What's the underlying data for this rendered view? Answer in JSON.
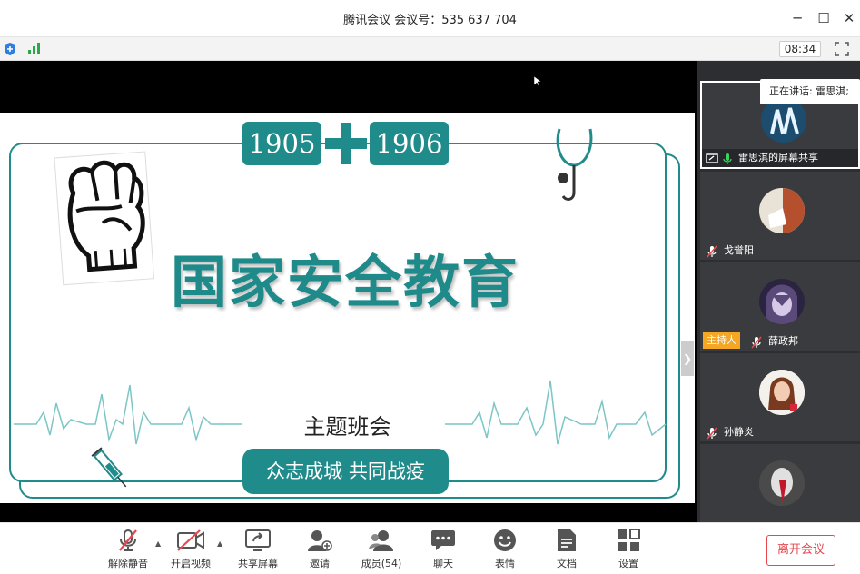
{
  "window": {
    "title": "腾讯会议 会议号：535 637 704",
    "minimize": "─",
    "maximize": "☐",
    "close": "✕"
  },
  "status": {
    "timer": "08:34",
    "icons": [
      "shield-icon",
      "signal-icon",
      "fullscreen-icon"
    ]
  },
  "slide": {
    "year_left": "1905",
    "year_right": "1906",
    "title": "国家安全教育",
    "subtitle": "主题班会",
    "slogan": "众志成城  共同战疫",
    "accent": "#208b8b"
  },
  "speaking": {
    "label": "正在讲话: 雷思淇;"
  },
  "participants": [
    {
      "name": "雷思淇的屏幕共享",
      "mic": "on",
      "sharing": true
    },
    {
      "name": "戈誉阳",
      "mic": "muted"
    },
    {
      "name": "薛政邦",
      "mic": "muted",
      "badge": "主持人"
    },
    {
      "name": "孙静炎",
      "mic": "muted"
    }
  ],
  "toolbar": {
    "unmute": "解除静音",
    "video": "开启视频",
    "share": "共享屏幕",
    "invite": "邀请",
    "members": "成员(54)",
    "chat": "聊天",
    "emoji": "表情",
    "docs": "文档",
    "settings": "设置",
    "leave": "离开会议"
  },
  "colors": {
    "leave": "#e5484d",
    "host_badge": "#f5a623"
  }
}
